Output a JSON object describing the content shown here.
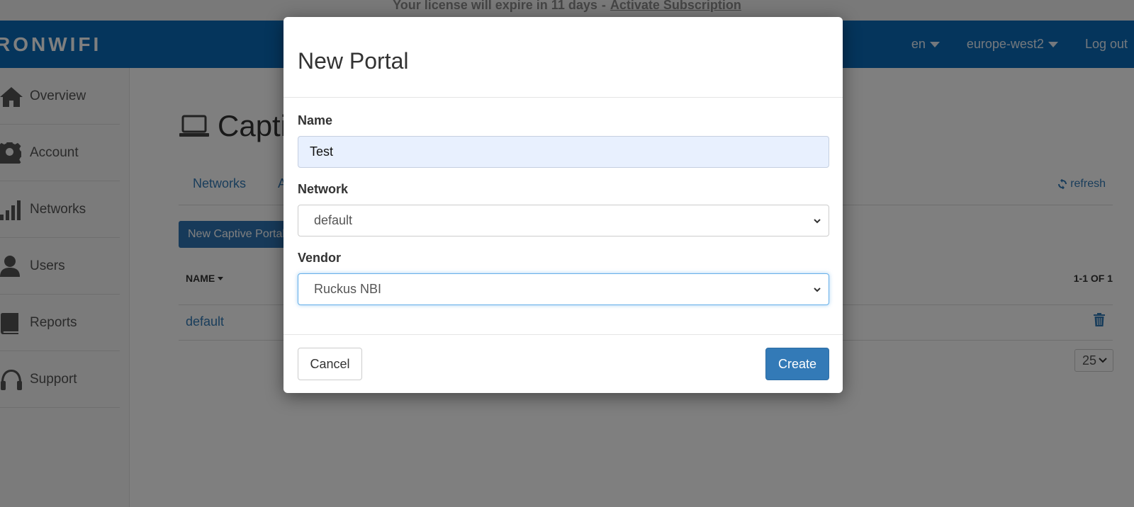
{
  "license_banner": {
    "message": "Your license will expire in 11 days",
    "separator": "-",
    "link": "Activate Subscription"
  },
  "topnav": {
    "logo": "RONWIFI",
    "language": "en",
    "region": "europe-west2",
    "logout": "Log out"
  },
  "sidebar": {
    "items": [
      {
        "label": "Overview",
        "icon": "home-icon"
      },
      {
        "label": "Account",
        "icon": "gear-icon"
      },
      {
        "label": "Networks",
        "icon": "signal-bars-icon"
      },
      {
        "label": "Users",
        "icon": "user-icon"
      },
      {
        "label": "Reports",
        "icon": "book-icon"
      },
      {
        "label": "Support",
        "icon": "headset-icon"
      }
    ]
  },
  "main": {
    "title": "Captiv",
    "tabs": [
      "Networks",
      "A"
    ],
    "refresh": "refresh",
    "new_button": "New Captive Portal",
    "table": {
      "columns": [
        "NAME"
      ],
      "paging": "1-1 OF 1",
      "rows": [
        {
          "name": "default"
        }
      ],
      "page_size": "25"
    }
  },
  "modal": {
    "title": "New Portal",
    "fields": {
      "name_label": "Name",
      "name_value": "Test",
      "network_label": "Network",
      "network_value": "default",
      "vendor_label": "Vendor",
      "vendor_value": "Ruckus NBI"
    },
    "cancel": "Cancel",
    "create": "Create"
  },
  "colors": {
    "nav": "#0a6bb8",
    "primary": "#337ab7",
    "input_autofill": "#e8f0fe",
    "focus": "#66afe9"
  }
}
